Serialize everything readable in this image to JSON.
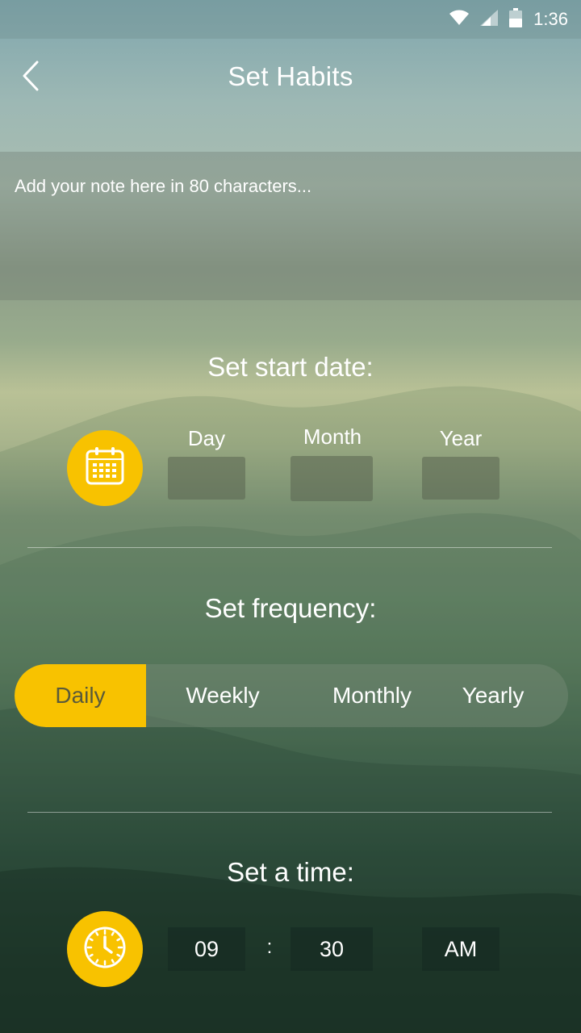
{
  "status_bar": {
    "time": "1:36",
    "icons": [
      "wifi-icon",
      "signal-icon",
      "battery-icon"
    ]
  },
  "header": {
    "title": "Set Habits",
    "back_icon": "chevron-left-icon"
  },
  "note": {
    "placeholder": "Add your note here in 80 characters..."
  },
  "start_date": {
    "title": "Set start date:",
    "icon": "calendar-icon",
    "labels": {
      "day": "Day",
      "month": "Month",
      "year": "Year"
    },
    "values": {
      "day": "",
      "month": "",
      "year": ""
    }
  },
  "frequency": {
    "title": "Set frequency:",
    "options": [
      "Daily",
      "Weekly",
      "Monthly",
      "Yearly"
    ],
    "selected": "Daily"
  },
  "time": {
    "title": "Set a time:",
    "icon": "clock-icon",
    "hour": "09",
    "separator": ":",
    "minute": "30",
    "period": "AM"
  },
  "colors": {
    "accent": "#f8c200",
    "text": "#ffffff"
  }
}
